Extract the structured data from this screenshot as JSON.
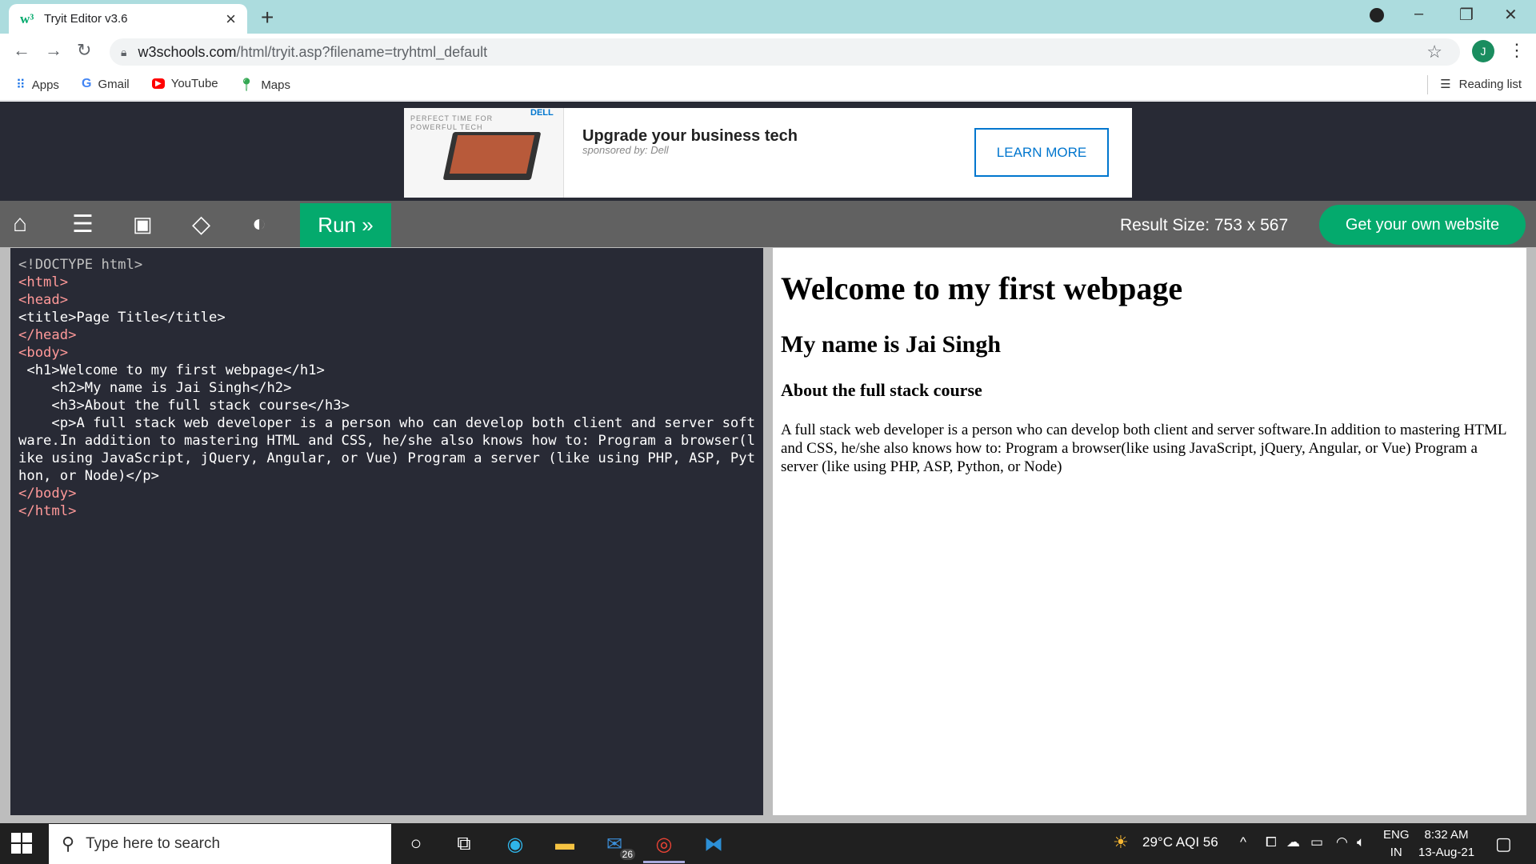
{
  "browser": {
    "tab_title": "Tryit Editor v3.6",
    "url_host": "w3schools.com",
    "url_path": "/html/tryit.asp?filename=tryhtml_default",
    "profile_initial": "J",
    "bookmarks": [
      "Apps",
      "Gmail",
      "YouTube",
      "Maps"
    ],
    "reading_list": "Reading list"
  },
  "ad": {
    "tagline": "PERFECT TIME FOR POWERFUL TECH",
    "brand": "DELL",
    "headline": "Upgrade your business tech",
    "sponsor": "sponsored by: Dell",
    "cta": "LEARN MORE"
  },
  "toolbar": {
    "run_label": "Run »",
    "result_size": "Result Size: 753 x 567",
    "get_site": "Get your own website"
  },
  "editor": {
    "lines": [
      "<!DOCTYPE html>",
      "<html>",
      "<head>",
      "<title>Page Title</title>",
      "</head>",
      "<body>",
      " <h1>Welcome to my first webpage</h1>",
      "    <h2>My name is Jai Singh</h2>",
      "    <h3>About the full stack course</h3>",
      "    <p>A full stack web developer is a person who can develop both client and server software.In addition to mastering HTML and CSS, he/she also knows how to: Program a browser(like using JavaScript, jQuery, Angular, or Vue) Program a server (like using PHP, ASP, Python, or Node)</p>",
      "</body>",
      "</html>"
    ]
  },
  "result": {
    "h1": "Welcome to my first webpage",
    "h2": "My name is Jai Singh",
    "h3": "About the full stack course",
    "p": "A full stack web developer is a person who can develop both client and server software.In addition to mastering HTML and CSS, he/she also knows how to: Program a browser(like using JavaScript, jQuery, Angular, or Vue) Program a server (like using PHP, ASP, Python, or Node)"
  },
  "taskbar": {
    "search_placeholder": "Type here to search",
    "mail_badge": "26",
    "weather": "29°C  AQI 56",
    "lang_top": "ENG",
    "lang_bottom": "IN",
    "time": "8:32 AM",
    "date": "13-Aug-21"
  }
}
